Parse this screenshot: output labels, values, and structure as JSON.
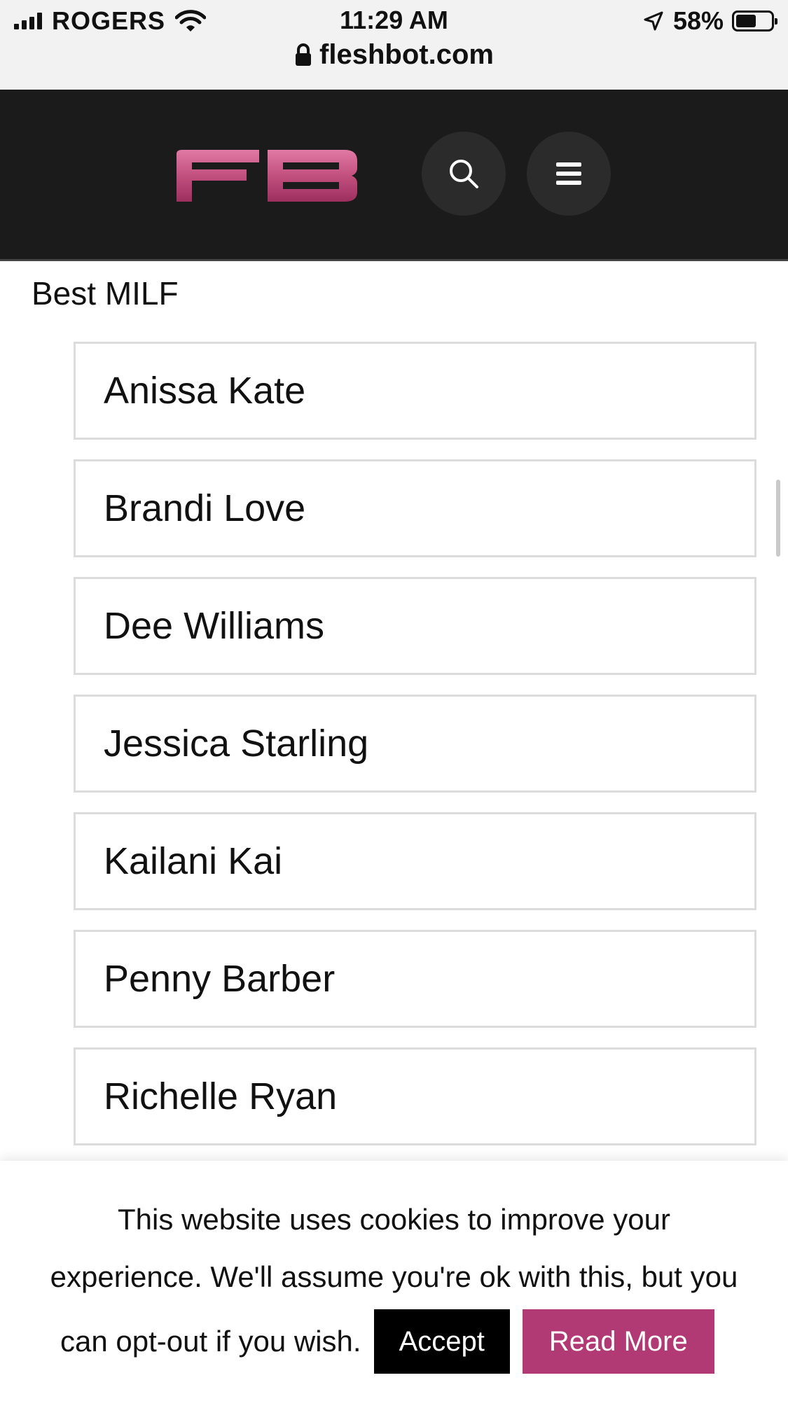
{
  "status_bar": {
    "carrier": "ROGERS",
    "time": "11:29 AM",
    "battery_percent": "58%",
    "battery_level": 0.58,
    "url": "fleshbot.com"
  },
  "header": {
    "logo_text": "FB",
    "search_icon": "search-icon",
    "menu_icon": "hamburger-menu-icon",
    "logo_color": "#c2507f",
    "background": "#1b1b1b"
  },
  "section": {
    "title": "Best MILF",
    "items": [
      {
        "label": "Anissa Kate"
      },
      {
        "label": "Brandi Love"
      },
      {
        "label": "Dee Williams"
      },
      {
        "label": "Jessica Starling"
      },
      {
        "label": "Kailani Kai"
      },
      {
        "label": "Penny Barber"
      },
      {
        "label": "Richelle Ryan"
      }
    ]
  },
  "cookie_banner": {
    "line1": "This website uses cookies to improve your",
    "line2": "experience. We'll assume you're ok with this, but you",
    "line3": "can opt-out if you wish.",
    "accept_label": "Accept",
    "read_more_label": "Read More",
    "accent_color": "#b13a74"
  }
}
